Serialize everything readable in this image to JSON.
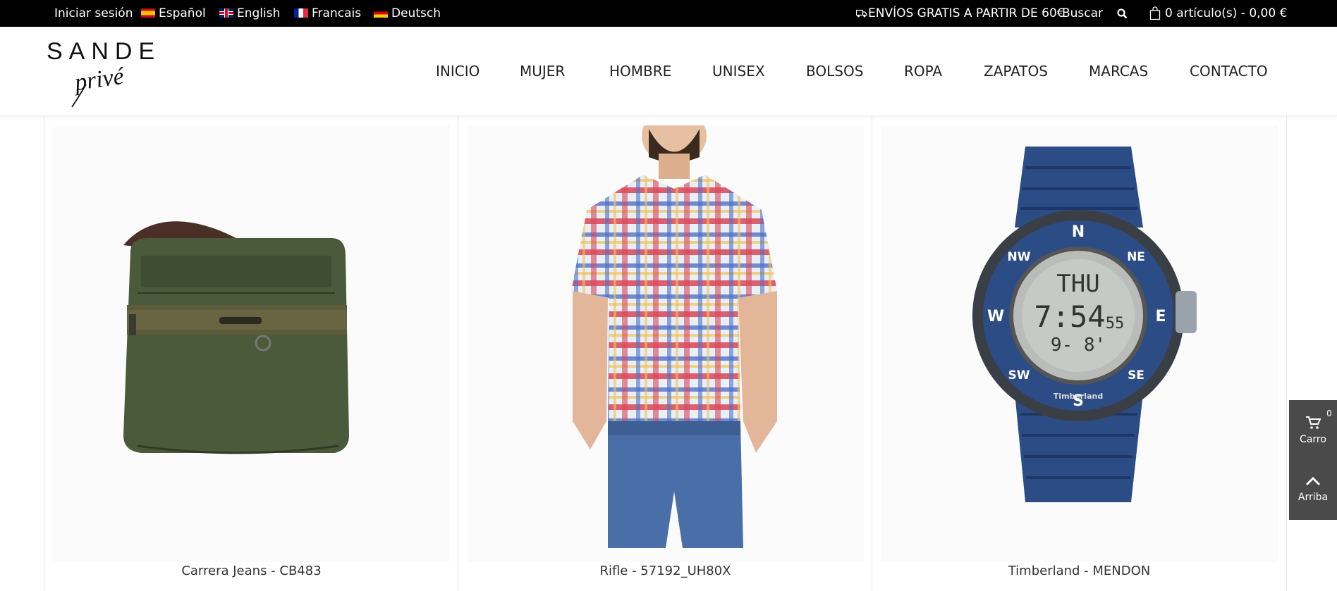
{
  "topbar": {
    "login": "Iniciar sesión",
    "languages": [
      "Español",
      "English",
      "Francais",
      "Deutsch"
    ],
    "shipping": "ENVÍOS GRATIS A PARTIR DE 60€",
    "search": "Buscar",
    "cart": "0 artículo(s) - 0,00 €"
  },
  "logo": {
    "brand": "SANDE",
    "sub": "privé"
  },
  "nav": [
    "INICIO",
    "MUJER",
    "HOMBRE",
    "UNISEX",
    "BOLSOS",
    "ROPA",
    "ZAPATOS",
    "MARCAS",
    "CONTACTO"
  ],
  "products": [
    {
      "name": "Carrera Jeans - CB483"
    },
    {
      "name": "Rifle - 57192_UH80X"
    },
    {
      "name": "Timberland - MENDON"
    }
  ],
  "watch": {
    "day": "THU",
    "time": "7:54",
    "seconds": "55",
    "line3": "9- 8'",
    "brand": "Timberland",
    "n": "N",
    "e": "E",
    "s": "S",
    "w": "W",
    "ne": "NE",
    "nw": "NW",
    "se": "SE",
    "sw": "SW"
  },
  "side": {
    "cart_label": "Carro",
    "cart_count": "0",
    "top_label": "Arriba"
  },
  "colors": {
    "topbar": "#000000",
    "side": "#4a4a4a",
    "bag": "#4b5a3a",
    "strap": "#4a2f26",
    "watch": "#2c4c85"
  }
}
